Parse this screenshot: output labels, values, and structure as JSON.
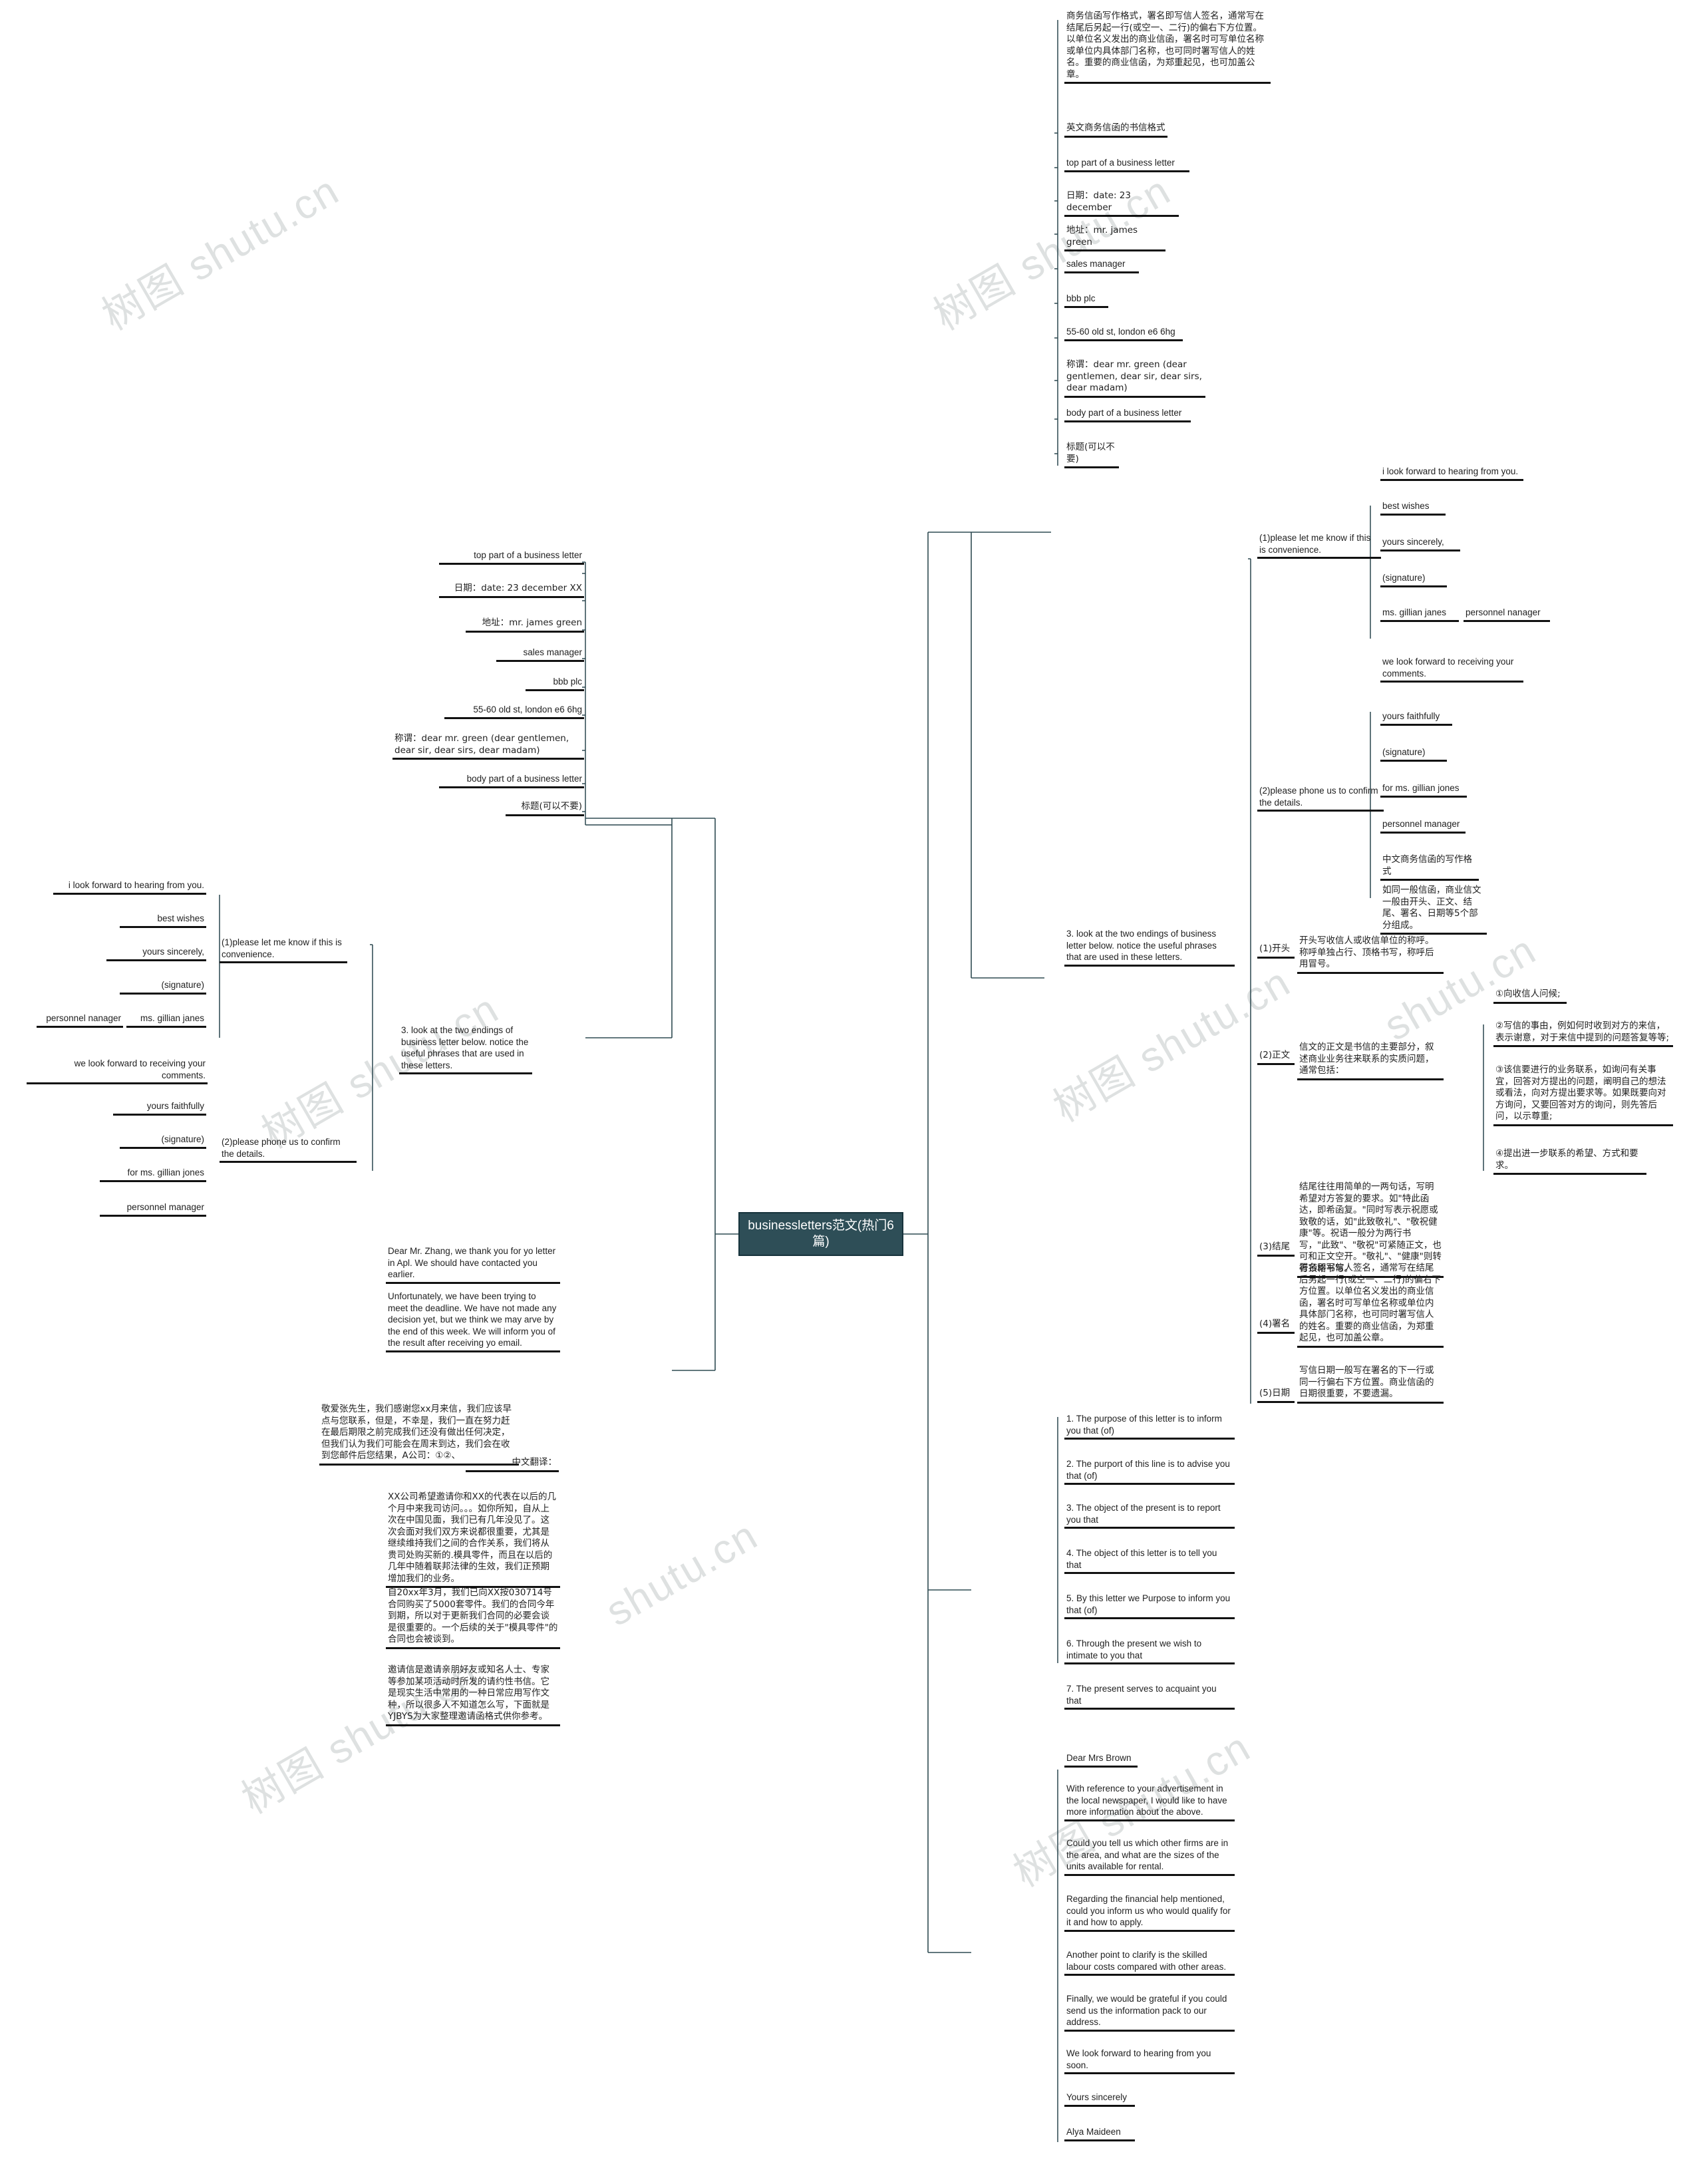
{
  "root": {
    "title": "businessletters范文(热门6篇)"
  },
  "watermarks": [
    "树图 shutu.cn",
    "shutu.cn",
    "树图 shutu.cn",
    "shutu.cn",
    "树图 shutu.cn",
    "shutu.cn",
    "树图 shutu",
    "shutu.cn"
  ],
  "colors": {
    "root_fill": "#2e4e57",
    "root_border": "#16323b",
    "underline": "#111111",
    "accent_underline": "#3d5b63",
    "text": "#1f1f1f",
    "watermark": "#d9dcdc"
  },
  "branch_top_right": {
    "intro": "商务信函写作格式，署名即写信人签名，通常写在结尾后另起一行(或空一、二行)的偏右下方位置。以单位名义发出的商业信函，署名时可写单位名称或单位内具体部门名称，也可同时署写信人的姓名。重要的商业信函，为郑重起见，也可加盖公章。",
    "items": [
      "英文商务信函的书信格式",
      "top part of a business letter",
      "日期：date: 23 december",
      "地址：mr. james green",
      "sales manager",
      "bbb plc",
      "55-60 old st, london e6 6hg",
      "称谓：dear mr. green (dear gentlemen, dear sir, dear sirs, dear madam)",
      "body part of a business letter",
      "标题(可以不要)"
    ]
  },
  "branch_endings": {
    "heading": "3. look at the two endings of business letter below. notice the useful phrases that are used in these letters.",
    "group1": {
      "label": "(1)please let me know if this is convenience.",
      "items": [
        "i look forward to hearing from you.",
        "best wishes",
        "yours sincerely,",
        "(signature)",
        "ms. gillian janes",
        "personnel nanager"
      ]
    },
    "group2": {
      "label": "(2)please phone us to confirm the details.",
      "items": [
        "we look forward to receiving your comments.",
        "yours faithfully",
        "(signature)",
        "for ms. gillian jones",
        "personnel manager",
        "中文商务信函的写作格式",
        "如同一般信函，商业信文一般由开头、正文、结尾、署名、日期等5个部分组成。"
      ]
    }
  },
  "branch_chinese_format": {
    "sections": [
      {
        "label": "(1)开头",
        "text": "开头写收信人或收信单位的称呼。称呼单独占行、顶格书写，称呼后用冒号。"
      },
      {
        "label": "(2)正文",
        "text": "信文的正文是书信的主要部分，叙述商业业务往来联系的实质问题，通常包括：",
        "children": [
          "①向收信人问候;",
          "②写信的事由，例如何时收到对方的来信，表示谢意，对于来信中提到的问题答复等等;",
          "③该信要进行的业务联系，如询问有关事宜，回答对方提出的问题，阐明自己的想法或看法，向对方提出要求等。如果既要向对方询问，又要回答对方的询问，则先答后问，以示尊重;",
          "④提出进一步联系的希望、方式和要求。"
        ]
      },
      {
        "label": "(3)结尾",
        "text": "结尾往往用简单的一两句话，写明希望对方答复的要求。如\"特此函达，即希函复。\"同时写表示祝愿或致敬的话，如\"此致敬礼\"、\"敬祝健康\"等。祝语一般分为两行书写，\"此致\"、\"敬祝\"可紧随正文，也可和正文空开。\"敬礼\"、\"健康\"则转行顶格书写。"
      },
      {
        "label": "(4)署名",
        "text": "署名即写信人签名，通常写在结尾后另起一行(或空一、二行)的偏右下方位置。以单位名义发出的商业信函，署名时可写单位名称或单位内具体部门名称，也可同时署写信人的姓名。重要的商业信函，为郑重起见，也可加盖公章。"
      },
      {
        "label": "(5)日期",
        "text": "写信日期一般写在署名的下一行或同一行偏右下方位置。商业信函的日期很重要，不要遗漏。"
      }
    ]
  },
  "branch_purpose_list": {
    "items": [
      "1. The purpose of this letter is to inform you that (of)",
      "2. The purport of this line is to advise you that (of)",
      "3. The object of the present is to report you that",
      "4. The object of this letter is to tell you that",
      "5. By this letter we Purpose to inform you that (of)",
      "6. Through the present we wish to intimate to you that",
      "7. The present serves to acquaint you that"
    ]
  },
  "branch_sample_letter": {
    "items": [
      "Dear Mrs Brown",
      "With reference to your advertisement in the local newspaper, I would like to have more information about the above.",
      "Could you tell us which other firms are in the area, and what are the sizes of the units available for rental.",
      "Regarding the financial help mentioned, could you inform us who would qualify for it and how to apply.",
      "Another point to clarify is the skilled labour costs compared with other areas.",
      "Finally, we would be grateful if you could send us the information pack to our address.",
      "We look forward to hearing from you soon.",
      "Yours sincerely",
      "Alya Maideen"
    ]
  },
  "branch_left_top": {
    "items": [
      "top part of a business letter",
      "日期：date: 23 december XX",
      "地址：mr. james green",
      "sales manager",
      "bbb plc",
      "55-60 old st, london e6 6hg",
      "称谓：dear mr. green (dear gentlemen, dear sir, dear sirs, dear madam)",
      "body part of a business letter",
      "标题(可以不要)"
    ]
  },
  "branch_left_endings": {
    "heading": "3. look at the two endings of business letter below. notice the useful phrases that are used in these letters.",
    "group1": {
      "label": "(1)please let me know if this is convenience.",
      "items": [
        "i look forward to hearing from you.",
        "best wishes",
        "yours sincerely,",
        "(signature)",
        "ms. gillian janes",
        "personnel nanager"
      ]
    },
    "group2": {
      "label": "(2)please phone us to confirm the details.",
      "items": [
        "we look forward to receiving your comments.",
        "yours faithfully",
        "(signature)",
        "for ms. gillian jones",
        "personnel manager"
      ]
    }
  },
  "branch_left_bottom": {
    "items": [
      "Dear Mr. Zhang, we thank you for yo letter in Apl. We should have contacted you earlier.",
      "Unfortunately, we have been trying to meet the deadline. We have not made any decision yet, but we think we may arve by the end of this week. We will inform you of the result after receiving yo email.",
      "敬爱张先生，我们感谢您xx月来信，我们应该早点与您联系，但是，不幸是，我们一直在努力赶在最后期限之前完成我们还没有做出任何决定，但我们认为我们可能会在周末到达，我们会在收到您邮件后您结果，A公司：①②、",
      "中文翻译：",
      "XX公司希望邀请你和XX的代表在以后的几个月中来我司访问。。。如你所知，自从上次在中国见面，我们已有几年没见了。这次会面对我们双方来说都很重要，尤其是继续维持我们之间的合作关系，我们将从贵司处购买新的.模具零件，而且在以后的几年中随着联邦法律的生效，我们正预期增加我们的业务。",
      "自20xx年3月，我们已向XX按030714号合同购买了5000套零件。我们的合同今年到期，所以对于更新我们合同的必要会谈是很重要的。一个后续的关于\"模具零件\"的合同也会被谈到。",
      "邀请信是邀请亲朋好友或知名人士、专家等参加某项活动时所发的请约性书信。它是现实生活中常用的一种日常应用写作文种，所以很多人不知道怎么写，下面就是YJBYS为大家整理邀请函格式供你参考。"
    ]
  }
}
